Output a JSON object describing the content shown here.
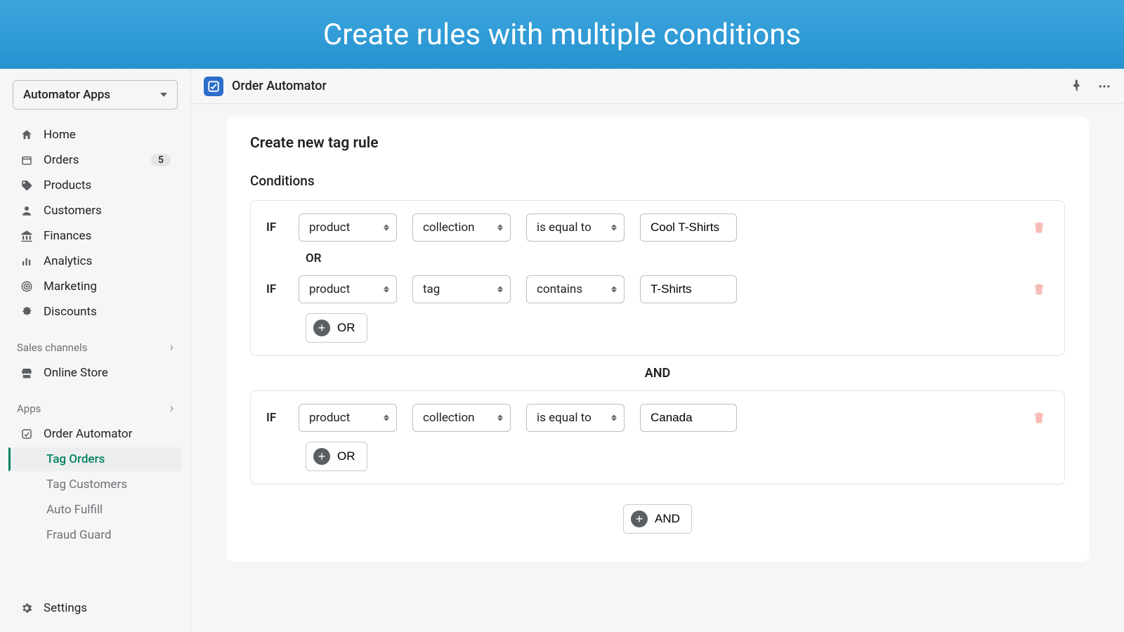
{
  "banner": {
    "title": "Create rules with multiple conditions"
  },
  "sidebar": {
    "switcher_label": "Automator Apps",
    "items": [
      {
        "label": "Home"
      },
      {
        "label": "Orders",
        "badge": "5"
      },
      {
        "label": "Products"
      },
      {
        "label": "Customers"
      },
      {
        "label": "Finances"
      },
      {
        "label": "Analytics"
      },
      {
        "label": "Marketing"
      },
      {
        "label": "Discounts"
      }
    ],
    "sales_channels_header": "Sales channels",
    "online_store": "Online Store",
    "apps_header": "Apps",
    "order_automator": "Order Automator",
    "sub": [
      {
        "label": "Tag Orders"
      },
      {
        "label": "Tag Customers"
      },
      {
        "label": "Auto Fulfill"
      },
      {
        "label": "Fraud Guard"
      }
    ],
    "settings": "Settings"
  },
  "topbar": {
    "app_title": "Order Automator"
  },
  "main": {
    "card_title": "Create new tag rule",
    "conditions_title": "Conditions",
    "if_label": "IF",
    "or_label": "OR",
    "and_label": "AND",
    "add_or": "OR",
    "add_and": "AND",
    "groups": [
      {
        "rows": [
          {
            "a": "product",
            "b": "collection",
            "c": "is equal to",
            "d": "Cool T-Shirts"
          },
          {
            "a": "product",
            "b": "tag",
            "c": "contains",
            "d": "T-Shirts"
          }
        ]
      },
      {
        "rows": [
          {
            "a": "product",
            "b": "collection",
            "c": "is equal to",
            "d": "Canada"
          }
        ]
      }
    ]
  }
}
